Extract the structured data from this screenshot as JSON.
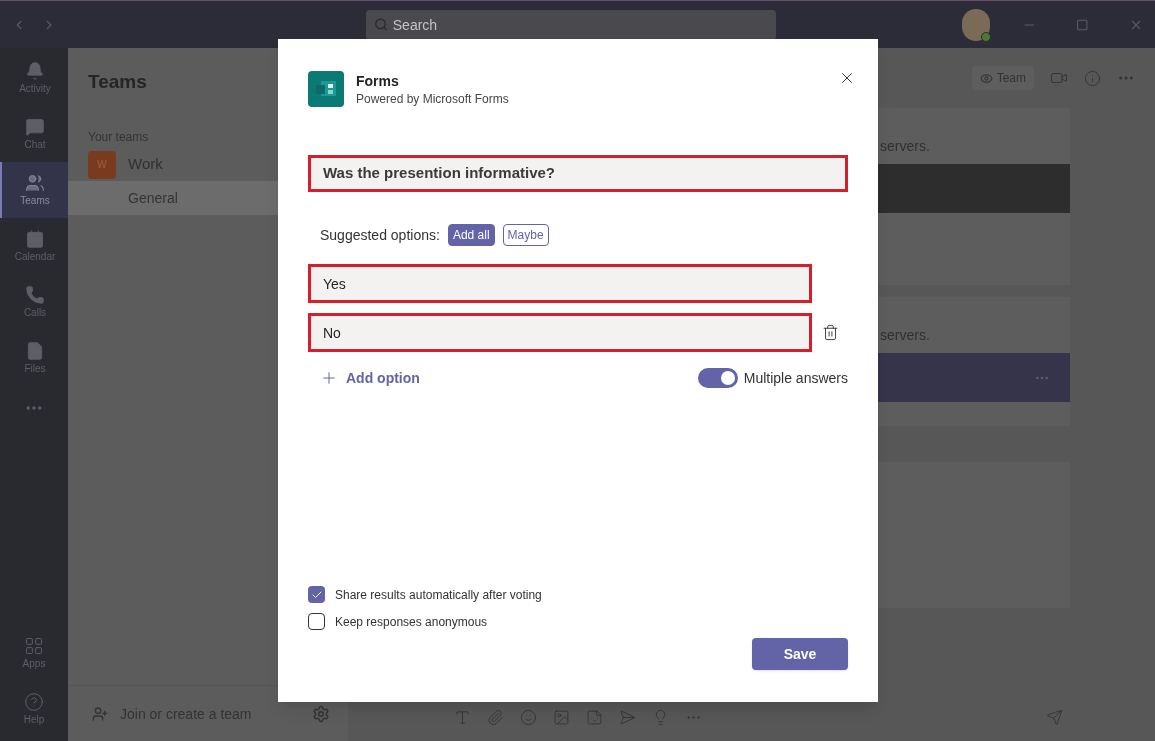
{
  "title_bar": {
    "search": {
      "placeholder": "Search"
    }
  },
  "app_bar": {
    "items": [
      {
        "label": "Activity",
        "kind": "bell",
        "selected": false
      },
      {
        "label": "Chat",
        "kind": "chat",
        "selected": false
      },
      {
        "label": "Teams",
        "kind": "teams",
        "selected": true
      },
      {
        "label": "Calendar",
        "kind": "calendar",
        "selected": false
      },
      {
        "label": "Calls",
        "kind": "phone",
        "selected": false
      },
      {
        "label": "Files",
        "kind": "file",
        "selected": false
      }
    ],
    "bottom": [
      {
        "label": "Apps",
        "kind": "apps"
      },
      {
        "label": "Help",
        "kind": "help"
      }
    ]
  },
  "teams_panel": {
    "title": "Teams",
    "section": "Your teams",
    "teams": [
      {
        "initial": "W",
        "name": "Work",
        "color": "#7a3a1e",
        "channels": [
          {
            "name": "General",
            "selected": true
          }
        ]
      }
    ],
    "join": "Join or create a team"
  },
  "channel_header": {
    "team_button": "Team"
  },
  "posts": [
    {
      "text": "servers.",
      "color": "#2d2d2d"
    },
    {
      "text": "servers.",
      "color": "#35344a"
    }
  ],
  "dialog": {
    "app_name": "Forms",
    "app_subtitle": "Powered by Microsoft Forms",
    "question": "Was the presention informative?",
    "suggested_label": "Suggested options:",
    "suggestions": [
      {
        "label": "Add all",
        "selected": true
      },
      {
        "label": "Maybe",
        "selected": false
      }
    ],
    "options": [
      {
        "value": "Yes",
        "deletable": false
      },
      {
        "value": "No",
        "deletable": true
      }
    ],
    "add_option": "Add option",
    "multiple": {
      "label": "Multiple answers",
      "on": true
    },
    "settings": [
      {
        "label": "Share results automatically after voting",
        "checked": true
      },
      {
        "label": "Keep responses anonymous",
        "checked": false
      }
    ],
    "save": "Save"
  }
}
